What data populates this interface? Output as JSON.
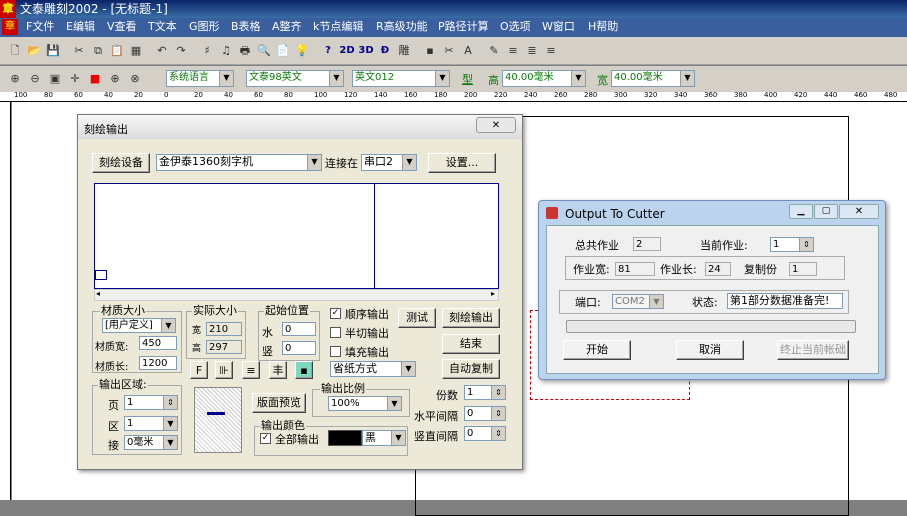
{
  "app": {
    "title": "文泰雕刻2002 - [无标题-1]",
    "logo_char": "章"
  },
  "menu": [
    "F文件",
    "E编辑",
    "V查看",
    "T文本",
    "G图形",
    "B表格",
    "A整齐",
    "k节点编辑",
    "R高级功能",
    "P路径计算",
    "O选项",
    "W窗口",
    "H帮助"
  ],
  "toolbar2": {
    "font_lang": "系统语言",
    "font_name": "文泰98英文",
    "font_en": "英文012",
    "type_label": "型",
    "height_label": "高",
    "height_value": "40.00毫米",
    "width_label": "宽",
    "width_value": "40.00毫米"
  },
  "toolbar_icons": {
    "row1": [
      "new-icon",
      "open-icon",
      "save-icon",
      "cut-icon",
      "copy-icon",
      "paste-icon",
      "print-preview-icon",
      "undo-icon",
      "redo-icon",
      "text-icon",
      "draw-icon",
      "print-icon",
      "page-icon",
      "bulb-icon",
      "help-icon",
      "2d-icon",
      "3d-icon",
      "mirror-icon",
      "carve-icon",
      "layer-icon",
      "scissors-icon",
      "text-box-icon",
      "edit-text-icon",
      "align-left-icon",
      "align-center-icon",
      "align-right-icon",
      "justify-icon"
    ],
    "row1_glyphs": [
      "🗋",
      "📂",
      "💾",
      "✂",
      "⧉",
      "📋",
      "▦",
      "↶",
      "↷",
      "♯",
      "♫",
      "🖶",
      "🔍",
      "📄",
      "💡",
      "?",
      "2D",
      "3D",
      "Ð",
      "雕",
      "▪",
      "✂",
      "A",
      "✎",
      "≡",
      "≣",
      "≡",
      "≡"
    ],
    "row2_glyphs": [
      "⊕",
      "⊖",
      "▣",
      "✛",
      "■",
      "⊕",
      "⊗"
    ]
  },
  "ruler": {
    "labels": [
      "100",
      "80",
      "60",
      "40",
      "20",
      "0",
      "20",
      "40",
      "60",
      "80",
      "100",
      "120",
      "140",
      "160",
      "180",
      "200",
      "220",
      "240",
      "260",
      "280",
      "300",
      "320",
      "340",
      "360",
      "380",
      "400",
      "420",
      "440",
      "460",
      "480"
    ]
  },
  "carve_dialog": {
    "title": "刻绘输出",
    "close": "✕",
    "device_btn": "刻绘设备",
    "device": "金伊泰1360刻字机",
    "port_label": "连接在",
    "port": "串口2",
    "settings_btn": "设置...",
    "material_group": "材质大小",
    "material_preset": "[用户定义]",
    "mat_width_label": "材质宽:",
    "mat_width": "450",
    "mat_length_label": "材质长:",
    "mat_length": "1200",
    "actual_group": "实际大小",
    "actual_w_label": "宽",
    "actual_w": "210",
    "actual_h_label": "高",
    "actual_h": "297",
    "origin_group": "起始位置",
    "origin_h_label": "水",
    "origin_h": "0",
    "origin_v_label": "竖",
    "origin_v": "0",
    "opt_sequential": "顺序输出",
    "opt_halfcut": "半切输出",
    "opt_fill": "填充输出",
    "save_mode": "省纸方式",
    "test_btn": "测试",
    "carve_btn": "刻绘输出",
    "end_btn": "结束",
    "auto_copy_btn": "自动复制",
    "output_area_group": "输出区域:",
    "page_label": "页",
    "page_value": "1",
    "area_label": "区",
    "area_value": "1",
    "join_label": "接",
    "join_value": "0毫米",
    "preview_btn": "版面预览",
    "scale_group": "输出比例",
    "scale": "100%",
    "color_group": "输出颜色",
    "all_output": "全部输出",
    "color_name": "黑",
    "copies_label": "份数",
    "copies": "1",
    "h_gap_label": "水平间隔",
    "h_gap": "0",
    "v_gap_label": "竖直间隔",
    "v_gap": "0"
  },
  "cutter_dialog": {
    "title": "Output To Cutter",
    "total_jobs_label": "总共作业",
    "total_jobs": "2",
    "current_job_label": "当前作业:",
    "current_job": "1",
    "job_width_label": "作业宽:",
    "job_width": "81",
    "job_length_label": "作业长:",
    "job_length": "24",
    "copies_label": "复制份",
    "copies": "1",
    "port_label": "端口:",
    "port": "COM2",
    "status_label": "状态:",
    "status": "第1部分数据准备完!",
    "start_btn": "开始",
    "cancel_btn": "取消",
    "stop_btn": "终止当前帐础"
  }
}
